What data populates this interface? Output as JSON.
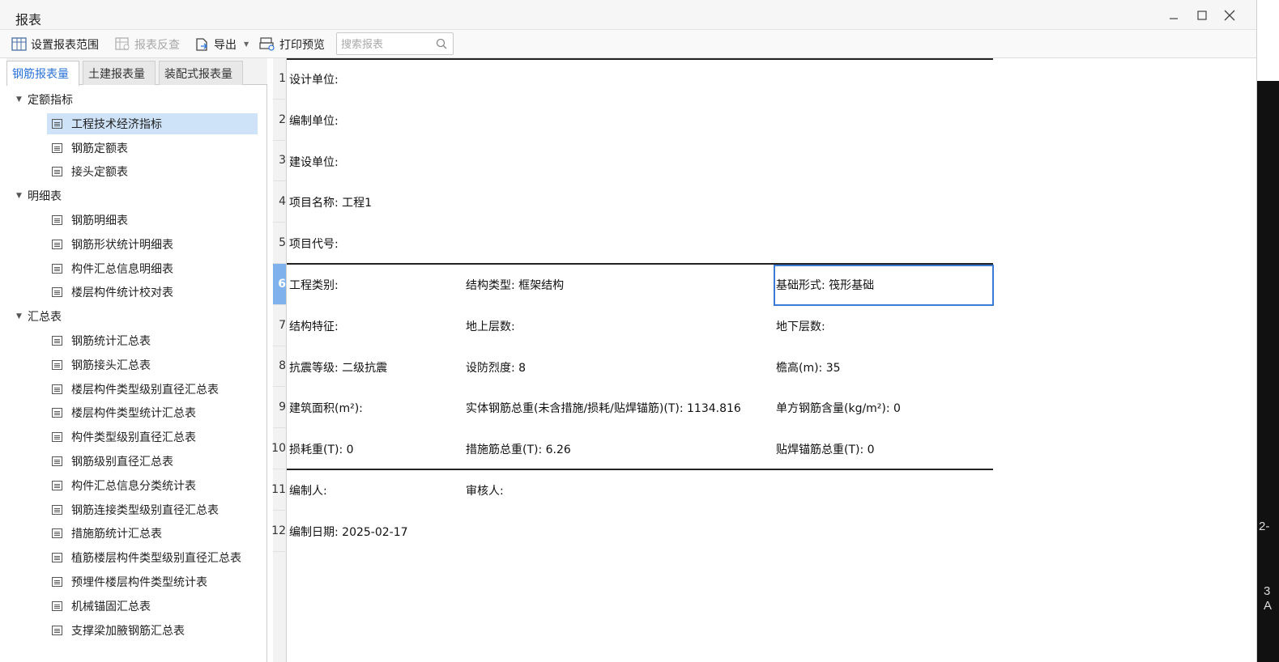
{
  "window": {
    "title": "报表"
  },
  "toolbar": {
    "set_range": "设置报表范围",
    "report_check": "报表反查",
    "export": "导出",
    "print_preview": "打印预览",
    "search_placeholder": "搜索报表"
  },
  "tabs": [
    "钢筋报表量",
    "土建报表量",
    "装配式报表量"
  ],
  "tree": {
    "groups": [
      {
        "label": "定额指标",
        "items": [
          "工程技术经济指标",
          "钢筋定额表",
          "接头定额表"
        ]
      },
      {
        "label": "明细表",
        "items": [
          "钢筋明细表",
          "钢筋形状统计明细表",
          "构件汇总信息明细表",
          "楼层构件统计校对表"
        ]
      },
      {
        "label": "汇总表",
        "items": [
          "钢筋统计汇总表",
          "钢筋接头汇总表",
          "楼层构件类型级别直径汇总表",
          "楼层构件类型统计汇总表",
          "构件类型级别直径汇总表",
          "钢筋级别直径汇总表",
          "构件汇总信息分类统计表",
          "钢筋连接类型级别直径汇总表",
          "措施筋统计汇总表",
          "植筋楼层构件类型级别直径汇总表",
          "预埋件楼层构件类型统计表",
          "机械锚固汇总表",
          "支撑梁加腋钢筋汇总表"
        ]
      }
    ],
    "selected": "工程技术经济指标"
  },
  "report": {
    "row_numbers": [
      "1",
      "2",
      "3",
      "4",
      "5",
      "6",
      "7",
      "8",
      "9",
      "10",
      "11",
      "12"
    ],
    "active_row": "6",
    "rows": [
      [
        "设计单位:"
      ],
      [
        "编制单位:"
      ],
      [
        "建设单位:"
      ],
      [
        "项目名称: 工程1"
      ],
      [
        "项目代号:"
      ],
      [
        "工程类别:",
        "结构类型: 框架结构",
        "基础形式: 筏形基础"
      ],
      [
        "结构特征:",
        "地上层数:",
        "地下层数:"
      ],
      [
        "抗震等级: 二级抗震",
        "设防烈度: 8",
        "檐高(m): 35"
      ],
      [
        "建筑面积(m²):",
        "实体钢筋总重(未含措施/损耗/贴焊锚筋)(T): 1134.816",
        "单方钢筋含量(kg/m²): 0"
      ],
      [
        "损耗重(T): 0",
        "措施筋总重(T): 6.26",
        "贴焊锚筋总重(T): 0"
      ],
      [
        "编制人:",
        "审核人:"
      ],
      [
        "编制日期: 2025-02-17"
      ]
    ]
  },
  "background": {
    "text1": "2-",
    "text2": "3",
    "text3": "A"
  },
  "colors": {
    "accent": "#2a73d9",
    "selected_bg": "#cfe3f8",
    "active_row": "#7fb2ec"
  }
}
